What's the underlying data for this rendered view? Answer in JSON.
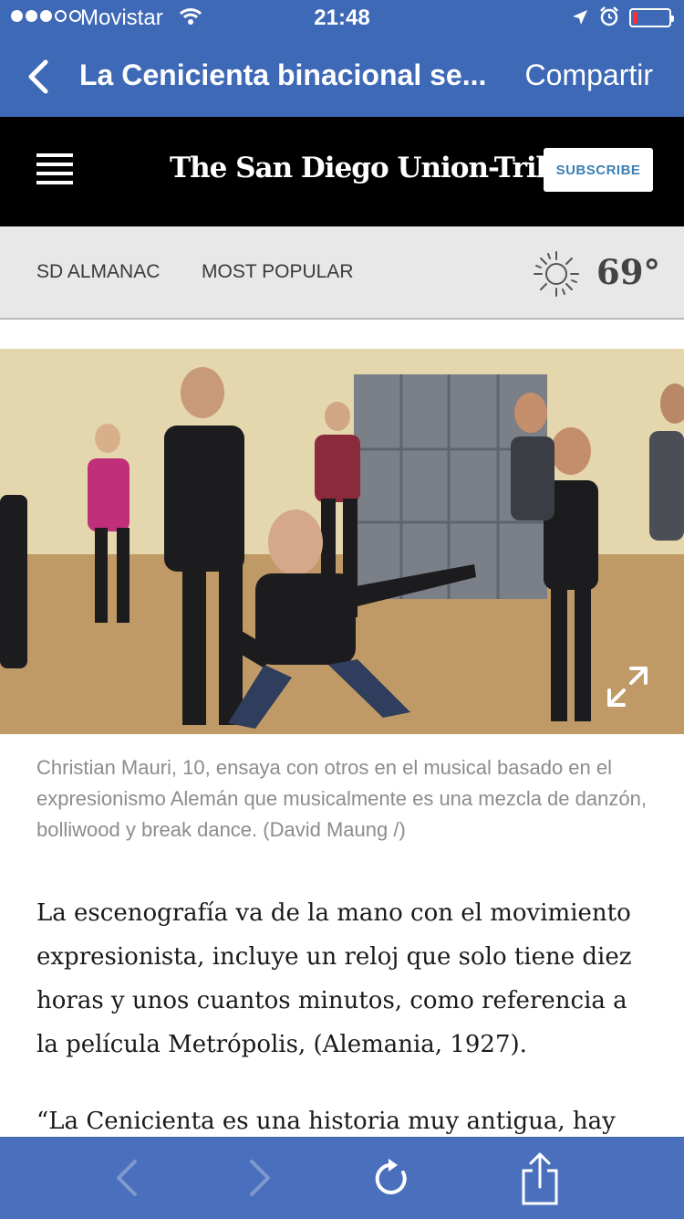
{
  "status_bar": {
    "carrier": "Movistar",
    "time": "21:48",
    "battery_color": "#ff2d2d",
    "icons": [
      "signal-dots",
      "wifi-icon",
      "location-icon",
      "alarm-icon",
      "battery-icon"
    ]
  },
  "nav_bar": {
    "title": "La Cenicienta binacional se...",
    "share_label": "Compartir",
    "background": "#3e69b7",
    "icons": [
      "chevron-left-icon"
    ]
  },
  "masthead": {
    "logo": "The San Diego Union-Tribune",
    "subscribe_label": "SUBSCRIBE",
    "icons": [
      "hamburger-menu-icon"
    ]
  },
  "sub_nav": {
    "links": [
      "SD ALMANAC",
      "MOST POPULAR"
    ],
    "temperature": "69°",
    "weather_icon": "sun-icon"
  },
  "article": {
    "photo": {
      "description_icon": "expand-icon"
    },
    "caption": "Christian Mauri, 10, ensaya con otros en el musical basado en el expresionismo Alemán que musicalmente es una mezcla de danzón, bolliwood y break dance. (David Maung /)",
    "paragraphs": [
      "La escenografía va de la mano con el movimiento expresionista, incluye un reloj que solo tiene diez horas y unos cuantos minutos, como referencia a la película Metrópolis, (Alemania, 1927).",
      "“La Cenicienta es una historia muy antigua, hay"
    ]
  },
  "toolbar": {
    "icons": [
      "back-arrow-icon",
      "forward-arrow-icon",
      "reload-icon",
      "share-icon"
    ],
    "background": "#4a70bd"
  }
}
